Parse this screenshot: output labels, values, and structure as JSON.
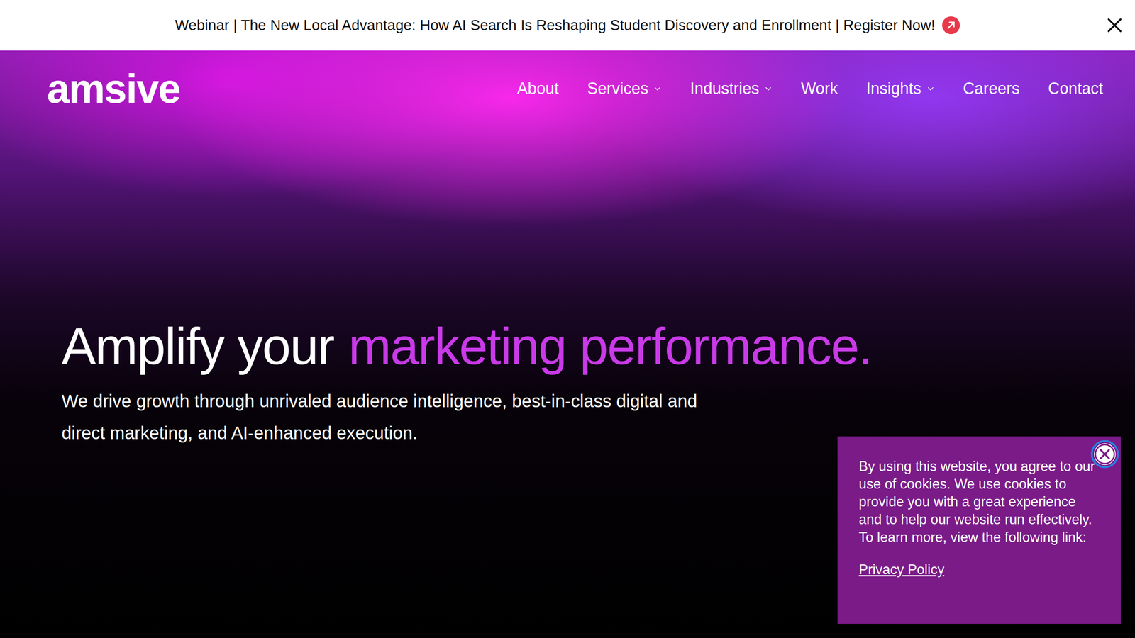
{
  "banner": {
    "text": "Webinar | The New Local Advantage: How AI Search Is Reshaping Student Discovery and Enrollment | Register Now!"
  },
  "logo": "amsive",
  "nav": [
    {
      "label": "About",
      "kind": "link"
    },
    {
      "label": "Services",
      "kind": "dropdown"
    },
    {
      "label": "Industries",
      "kind": "dropdown"
    },
    {
      "label": "Work",
      "kind": "link"
    },
    {
      "label": "Insights",
      "kind": "dropdown"
    },
    {
      "label": "Careers",
      "kind": "link"
    },
    {
      "label": "Contact",
      "kind": "link"
    }
  ],
  "hero": {
    "heading": "Amplify your",
    "heading_accent": "marketing performance.",
    "text": "We drive growth through unrivaled audience intelligence, best-in-class digital and direct marketing, and AI-enhanced execution."
  },
  "cookie": {
    "text": "By using this website, you agree to our use of cookies. We use cookies to provide you with a great experience and to help our website run effectively. To learn more, view the following link:",
    "link": "Privacy Policy"
  }
}
